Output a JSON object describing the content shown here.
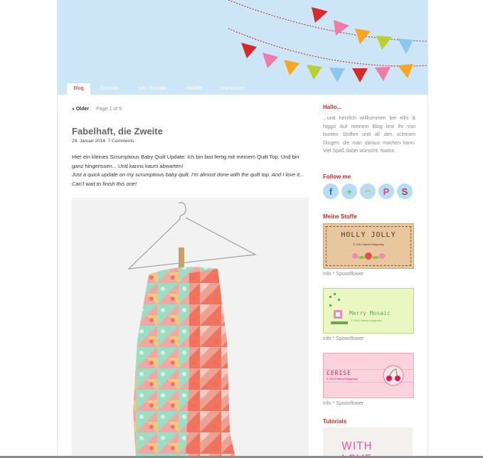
{
  "nav": {
    "items": [
      {
        "label": "Blog",
        "active": true
      },
      {
        "label": "Tutorials",
        "active": false
      },
      {
        "label": "Info / Kontakt",
        "active": false
      },
      {
        "label": "Händler",
        "active": false
      },
      {
        "label": "Impressum",
        "active": false
      }
    ]
  },
  "pager": {
    "older": "« Older",
    "page_info": "Page 1 of 9"
  },
  "post": {
    "title": "Fabelhaft, die Zweite",
    "meta": "28. Januar 2014. 7 Comments",
    "body_de": "Hier ein kleines Scrumptious Baby Quilt Update: Ich bin fast fertig mit meinem Quilt Top. Und bin ganz hingerissen... Und kanns kaum abwarten!",
    "body_en": "Just a quick update on my scrumptious baby quilt. I'm almost done with the quilt top. And I love it... Can't wait to finish this one!"
  },
  "sidebar": {
    "hallo_title": "Hallo...",
    "hallo_text": "...und herzlich willkommen bei ellis & higgs! Auf meinem Blog lest Ihr von bunten Stoffen und all den schönen Dingen, die man daraus machen kann. Viel Spaß dabei wünscht: Nadra",
    "follow_title": "Follow me",
    "social": [
      {
        "icon": "facebook-icon",
        "glyph": "f",
        "color": "#2f6fb5"
      },
      {
        "icon": "google-plus-icon",
        "glyph": "+",
        "color": "#7cc242"
      },
      {
        "icon": "flickr-icon",
        "glyph": "••",
        "color": "#f4b400"
      },
      {
        "icon": "pinterest-icon",
        "glyph": "P",
        "color": "#e24b6e"
      },
      {
        "icon": "spoonflower-icon",
        "glyph": "S",
        "color": "#c0392b"
      }
    ],
    "stoffe_title": "Meine Stoffe",
    "fabrics": [
      {
        "name": "HOLLY JOLLY",
        "sub": "© 2013 Nadra Ridgeway",
        "caption": "Info * Spoonflower"
      },
      {
        "name": "Merry Mosaic",
        "sub": "© 2013 Nadra Ridgeway",
        "caption": "Info * Spoonflower"
      },
      {
        "name": "CERISE",
        "sub": "© 2013 Nadra Ridgeway",
        "caption": "Info * Spoonflower"
      }
    ],
    "tutorials_title": "Tutorials",
    "tutorial_image_text": "WITH LOVE..."
  },
  "colors": {
    "accent": "#c62828",
    "header_sky": "#cde6f7"
  }
}
